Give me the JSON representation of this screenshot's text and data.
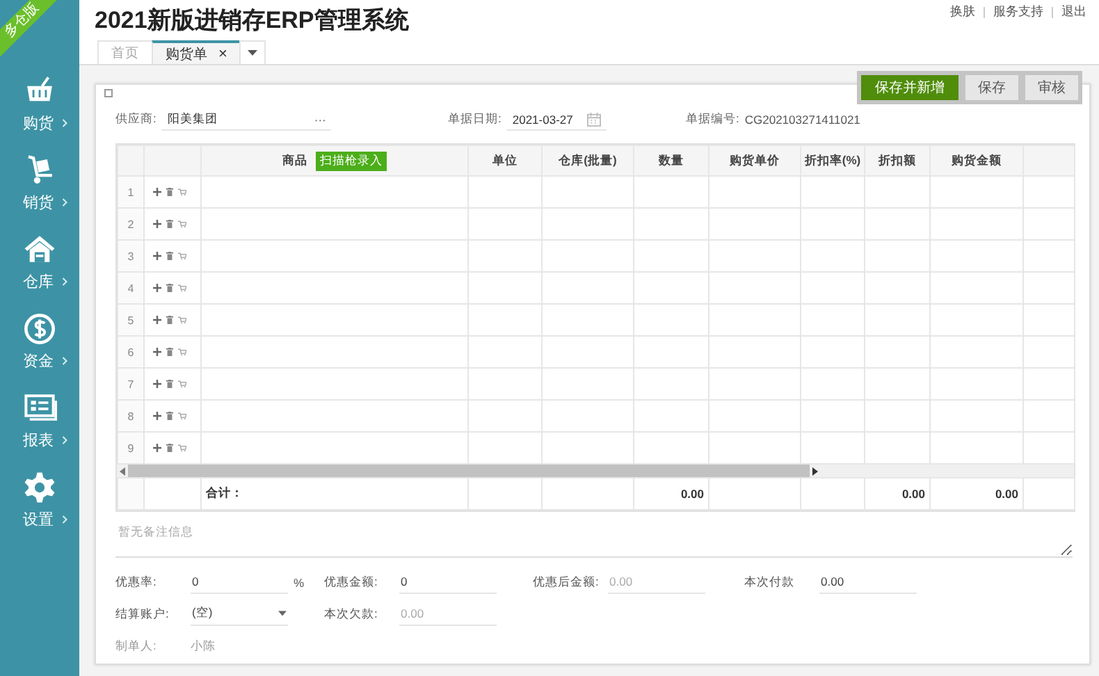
{
  "ribbon": {
    "text": "多仓版"
  },
  "header": {
    "title": "2021新版进销存ERP管理系统",
    "links": [
      "换肤",
      "服务支持",
      "退出"
    ]
  },
  "sidebar": {
    "items": [
      {
        "label": "购货"
      },
      {
        "label": "销货"
      },
      {
        "label": "仓库"
      },
      {
        "label": "资金"
      },
      {
        "label": "报表"
      },
      {
        "label": "设置"
      }
    ]
  },
  "tabs": [
    {
      "label": "首页",
      "selected": false,
      "closable": false
    },
    {
      "label": "购货单",
      "selected": true,
      "closable": true,
      "close": "×"
    }
  ],
  "actions": [
    {
      "label": "保存并新增",
      "primary": true
    },
    {
      "label": "保存",
      "primary": false
    },
    {
      "label": "审核",
      "primary": false
    }
  ],
  "form": {
    "supplier": {
      "label": "供应商:",
      "value": "阳美集团",
      "more": "···"
    },
    "date": {
      "label": "单据日期:",
      "value": "2021-03-27"
    },
    "number": {
      "label": "单据编号:",
      "value": "CG202103271411021"
    }
  },
  "table": {
    "columns": [
      {
        "label": "商品",
        "button": "扫描枪录入"
      },
      {
        "label": "单位"
      },
      {
        "label": "仓库(批量)"
      },
      {
        "label": "数量",
        "total": "0.00"
      },
      {
        "label": "购货单价"
      },
      {
        "label": "折扣率(%)"
      },
      {
        "label": "折扣额",
        "total": "0.00"
      },
      {
        "label": "购货金额",
        "total": "0.00"
      }
    ],
    "rows": [
      "1",
      "2",
      "3",
      "4",
      "5",
      "6",
      "7",
      "8",
      "9"
    ],
    "total_label": "合计："
  },
  "remarks": {
    "placeholder": "暂无备注信息"
  },
  "fields": [
    [
      {
        "kind": "text",
        "label": "优惠率:",
        "value": "0",
        "suffix": "%",
        "disabled": false
      },
      {
        "kind": "text",
        "label": "优惠金额:",
        "value": "0",
        "disabled": false
      },
      {
        "kind": "text",
        "label": "优惠后金额:",
        "value": "0.00",
        "disabled": true
      },
      {
        "kind": "text",
        "label": "本次付款",
        "value": "0.00",
        "disabled": false
      }
    ],
    [
      {
        "kind": "select",
        "label": "结算账户:",
        "value": "(空)",
        "disabled": false
      },
      {
        "kind": "text",
        "label": "本次欠款:",
        "value": "0.00",
        "disabled": true
      }
    ],
    [
      {
        "kind": "static",
        "label": "制单人:",
        "value": "小陈"
      }
    ]
  ]
}
